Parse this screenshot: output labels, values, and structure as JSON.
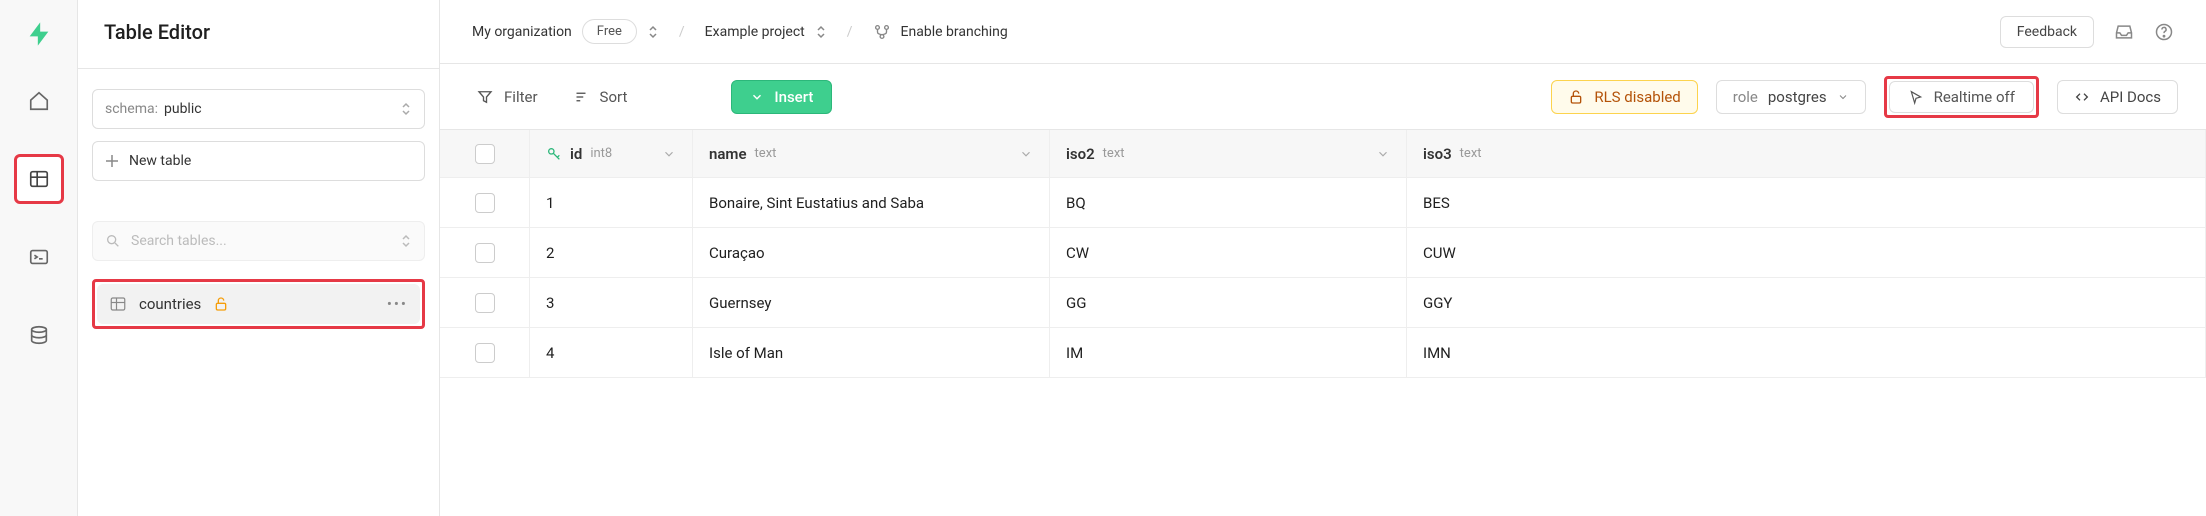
{
  "colors": {
    "accent": "#3ecf8e",
    "highlight": "#e63946",
    "warn": "#f59e0b"
  },
  "sidebar": {
    "title": "Table Editor",
    "schema_label": "schema:",
    "schema_value": "public",
    "new_table": "New table",
    "search_placeholder": "Search tables...",
    "table_name": "countries"
  },
  "crumb": {
    "org": "My organization",
    "plan": "Free",
    "project": "Example project",
    "branching": "Enable branching",
    "feedback": "Feedback"
  },
  "toolbar": {
    "filter": "Filter",
    "sort": "Sort",
    "insert": "Insert",
    "rls": "RLS disabled",
    "role_label": "role",
    "role_value": "postgres",
    "realtime": "Realtime off",
    "api_docs": "API Docs"
  },
  "columns": {
    "id": {
      "name": "id",
      "type": "int8"
    },
    "name": {
      "name": "name",
      "type": "text"
    },
    "iso2": {
      "name": "iso2",
      "type": "text"
    },
    "iso3": {
      "name": "iso3",
      "type": "text"
    }
  },
  "rows": [
    {
      "id": "1",
      "name": "Bonaire, Sint Eustatius and Saba",
      "iso2": "BQ",
      "iso3": "BES"
    },
    {
      "id": "2",
      "name": "Curaçao",
      "iso2": "CW",
      "iso3": "CUW"
    },
    {
      "id": "3",
      "name": "Guernsey",
      "iso2": "GG",
      "iso3": "GGY"
    },
    {
      "id": "4",
      "name": "Isle of Man",
      "iso2": "IM",
      "iso3": "IMN"
    }
  ]
}
